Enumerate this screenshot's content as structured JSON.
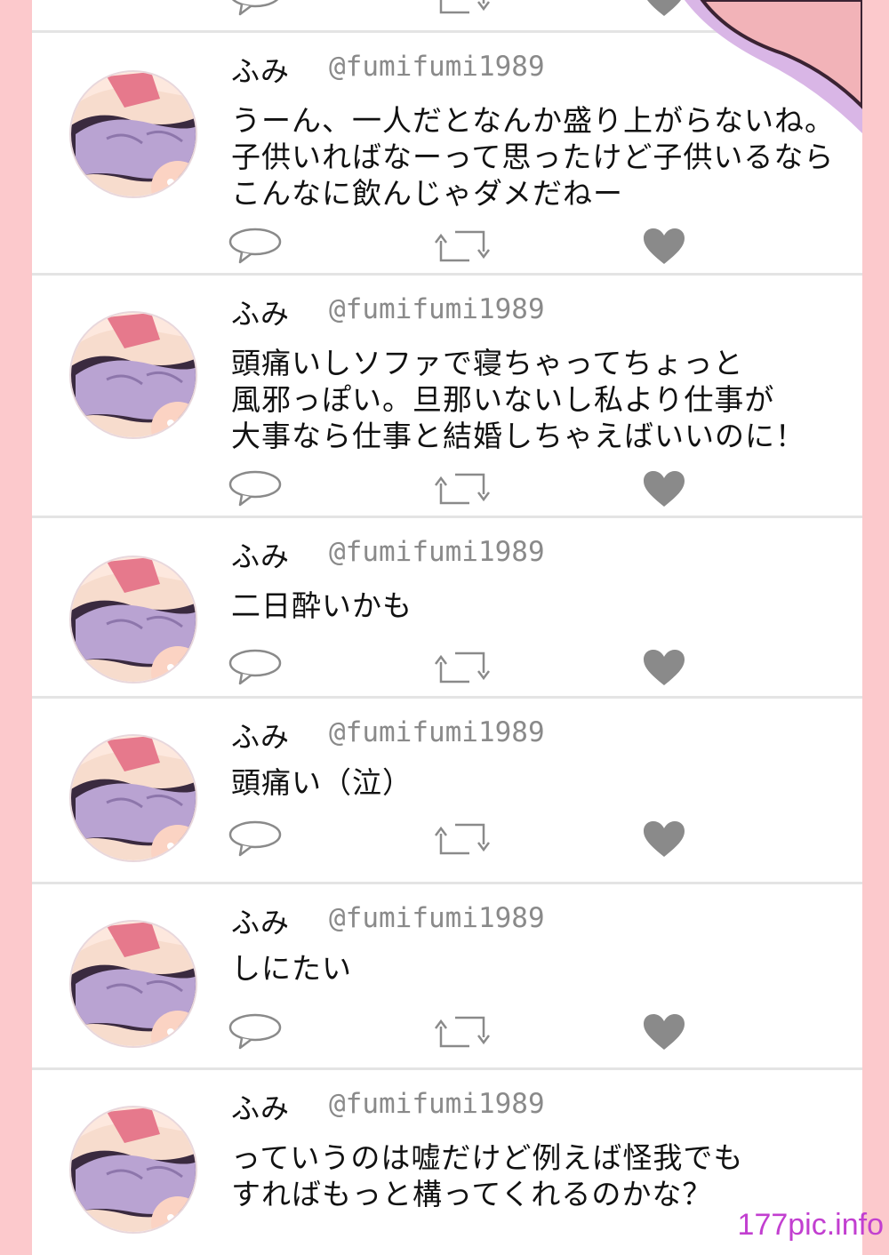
{
  "tweets": [
    {
      "name": "ふみ",
      "handle": "@fumifumi1989",
      "text": "うーん、一人だとなんか盛り上がらないね。\n子供いればなーって思ったけど子供いるなら\nこんなに飲んじゃダメだねー"
    },
    {
      "name": "ふみ",
      "handle": "@fumifumi1989",
      "text": "頭痛いしソファで寝ちゃってちょっと\n風邪っぽい。旦那いないし私より仕事が\n大事なら仕事と結婚しちゃえばいいのに！"
    },
    {
      "name": "ふみ",
      "handle": "@fumifumi1989",
      "text": "二日酔いかも"
    },
    {
      "name": "ふみ",
      "handle": "@fumifumi1989",
      "text": "頭痛い（泣）"
    },
    {
      "name": "ふみ",
      "handle": "@fumifumi1989",
      "text": "しにたい"
    },
    {
      "name": "ふみ",
      "handle": "@fumifumi1989",
      "text": "っていうのは嘘だけど例えば怪我でも\nすればもっと構ってくれるのかな？"
    }
  ],
  "icons": {
    "reply": "speech-bubble-icon",
    "retweet": "retweet-icon",
    "like": "heart-icon"
  },
  "colors": {
    "background": "#fcc9cc",
    "card": "#ffffff",
    "icon": "#8a8a8a",
    "watermark": "#c23fd0"
  },
  "watermark": "177pic.info"
}
